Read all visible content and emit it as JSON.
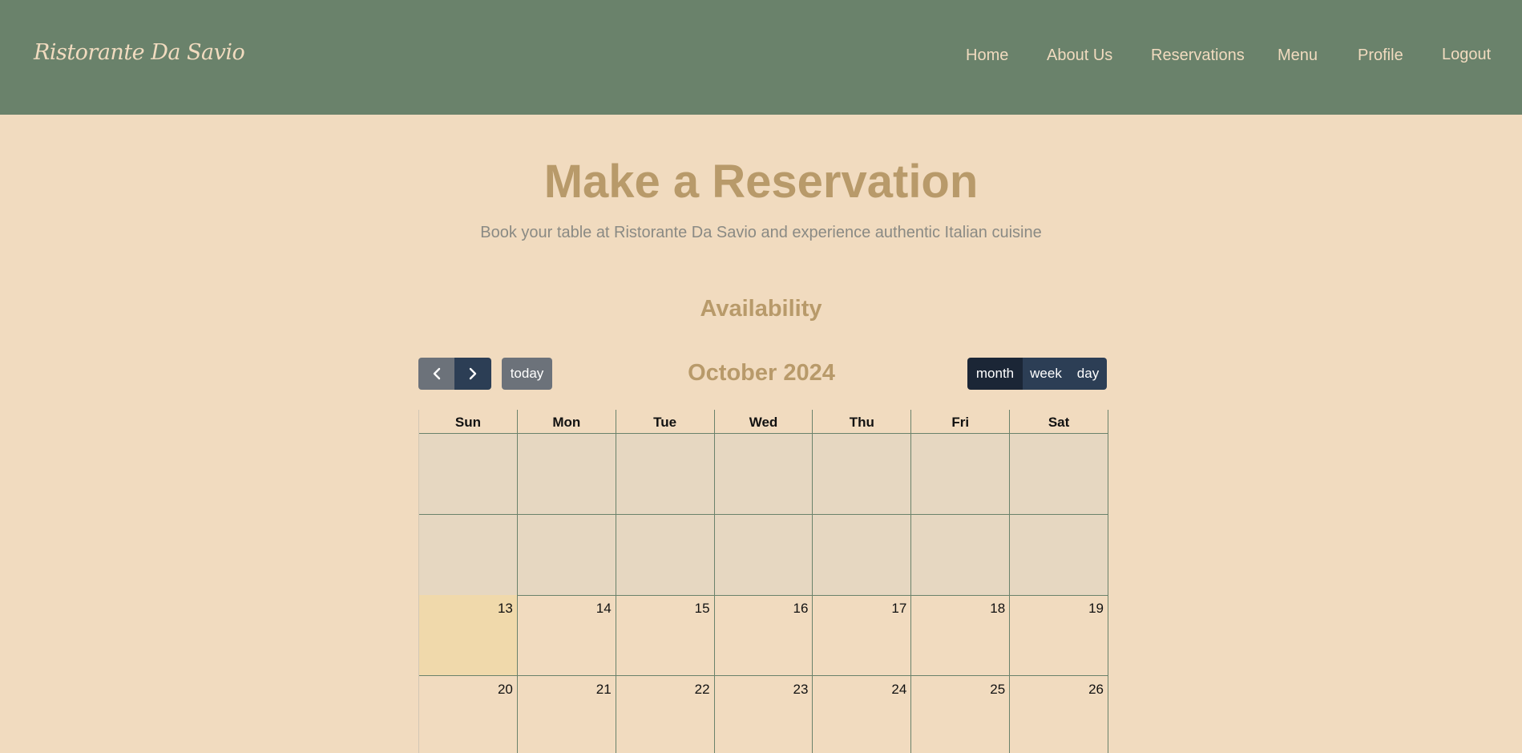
{
  "navbar": {
    "brand": "Ristorante Da Savio",
    "links": [
      "Home",
      "About Us",
      "Reservations",
      "Menu",
      "Profile",
      "Logout"
    ],
    "background": "#6a826b",
    "text_color": "#f1dbbf"
  },
  "hero": {
    "title": "Make a Reservation",
    "subtitle": "Book your table at Ristorante Da Savio and experience authentic Italian cuisine"
  },
  "availability": {
    "title": "Availability",
    "toolbar": {
      "prev_icon": "chevron-left-icon",
      "next_icon": "chevron-right-icon",
      "today_label": "today",
      "month_title": "October 2024",
      "views": [
        "month",
        "week",
        "day"
      ],
      "active_view": "month"
    },
    "calendar": {
      "weekdays": [
        "Sun",
        "Mon",
        "Tue",
        "Wed",
        "Thu",
        "Fri",
        "Sat"
      ],
      "weeks": [
        [
          "",
          "",
          "",
          "",
          "",
          "",
          ""
        ],
        [
          "",
          "",
          "",
          "",
          "",
          "",
          ""
        ],
        [
          "13",
          "14",
          "15",
          "16",
          "17",
          "18",
          "19"
        ],
        [
          "20",
          "21",
          "22",
          "23",
          "24",
          "25",
          "26"
        ]
      ],
      "today": "13",
      "past_color": "#e6d7c1",
      "today_color": "#f0d9ab"
    }
  },
  "colors": {
    "page_background": "#f1dbbf",
    "accent": "#b89a6a",
    "button_dark": "#2c3e55",
    "button_gray": "#6c727a"
  }
}
